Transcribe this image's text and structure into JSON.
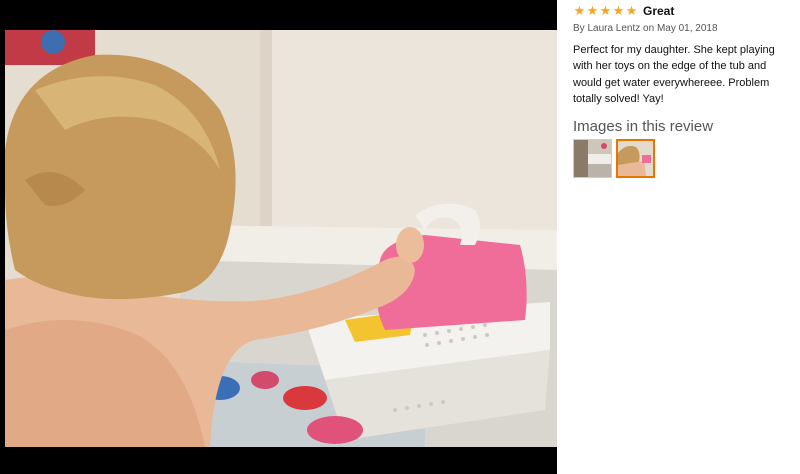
{
  "review": {
    "rating": 5,
    "star_glyph": "★",
    "title": "Great",
    "byline": "By Laura Lentz on May 01, 2018",
    "body": "Perfect for my daughter. She kept playing with her toys on the edge of the tub and would get water everywhereee. Problem totally solved! Yay!",
    "images_heading": "Images in this review",
    "selected_thumbnail": 2
  },
  "colors": {
    "star": "#f5a623",
    "selected_border": "#e77600",
    "letterbox": "#000000"
  },
  "thumbnails": [
    {
      "icon": "bathroom-thumbnail"
    },
    {
      "icon": "child-bath-thumbnail"
    }
  ]
}
